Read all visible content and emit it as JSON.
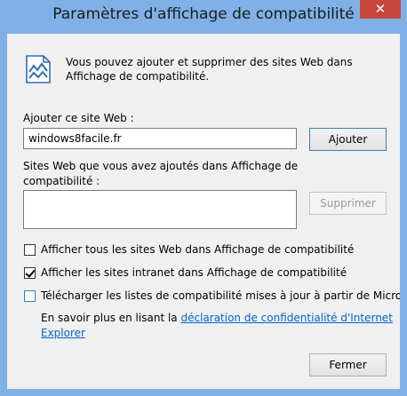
{
  "window": {
    "title": "Paramètres d'affichage de compatibilité",
    "close_glyph": "✕"
  },
  "info": {
    "text": "Vous pouvez ajouter et supprimer des sites Web dans Affichage de compatibilité.",
    "icon": "compatibility-view-icon"
  },
  "add_site": {
    "label": "Ajouter ce site Web :",
    "value": "windows8facile.fr",
    "button": "Ajouter"
  },
  "sites_list": {
    "label": "Sites Web que vous avez ajoutés dans Affichage de compatibilité :",
    "items": [],
    "remove_button": "Supprimer"
  },
  "options": [
    {
      "label": "Afficher tous les sites Web dans Affichage de compatibilité",
      "checked": false
    },
    {
      "label": "Afficher les sites intranet dans Affichage de compatibilité",
      "checked": true
    },
    {
      "label": "Télécharger les listes de compatibilité mises à jour à partir de Microso",
      "checked": false
    }
  ],
  "privacy": {
    "prefix": "En savoir plus en lisant la ",
    "link_line1": "déclaration de confidentialité d'Internet",
    "link_line2": "Explorer"
  },
  "close_button": "Fermer",
  "colors": {
    "frame": "#7fb1e6",
    "close": "#c7453a",
    "link": "#0066cc"
  }
}
